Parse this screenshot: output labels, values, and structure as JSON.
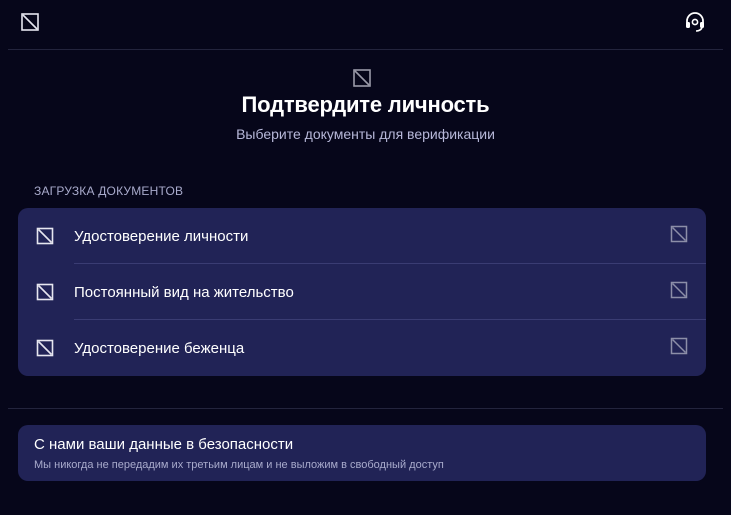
{
  "header": {
    "back_icon": "broken-image-icon",
    "support_icon": "headset-support-icon"
  },
  "hero": {
    "icon": "broken-image-icon",
    "title": "Подтвердите личность",
    "subtitle": "Выберите документы для верификации"
  },
  "documents": {
    "section_label": "ЗАГРУЗКА ДОКУМЕНТОВ",
    "items": [
      {
        "label": "Удостоверение личности",
        "icon": "broken-image-icon"
      },
      {
        "label": "Постоянный вид на жительство",
        "icon": "broken-image-icon"
      },
      {
        "label": "Удостоверение беженца",
        "icon": "broken-image-icon"
      }
    ]
  },
  "security": {
    "title": "С нами ваши данные в безопасности",
    "text": "Мы никогда не передадим их третьим лицам и не выложим в свободный доступ"
  },
  "colors": {
    "background": "#06061a",
    "card": "#212356",
    "muted_text": "#b7b8d9"
  }
}
